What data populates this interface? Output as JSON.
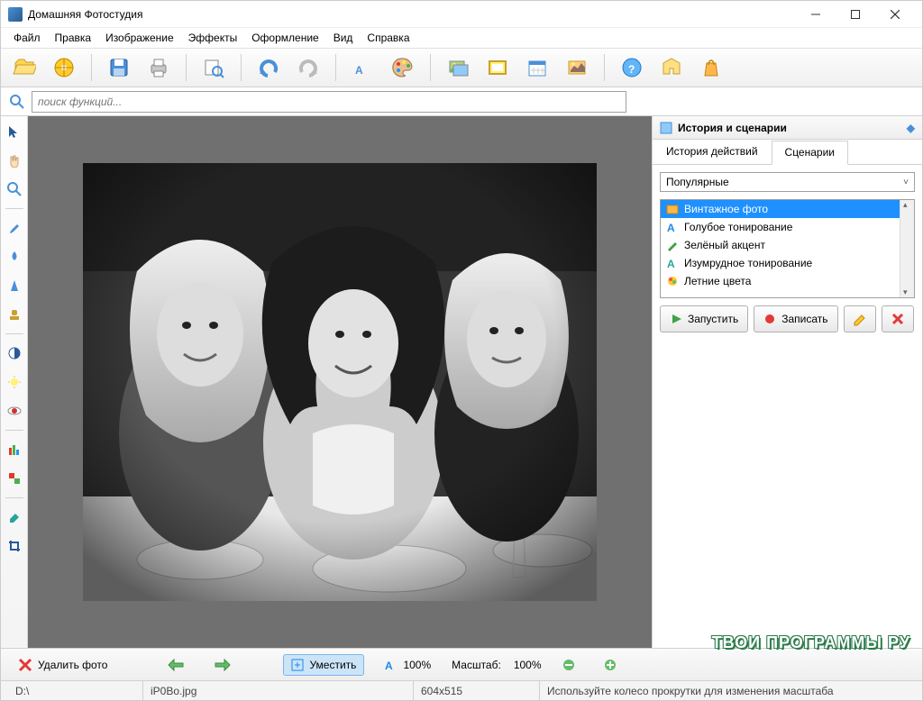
{
  "title": "Домашняя Фотостудия",
  "menu": [
    "Файл",
    "Правка",
    "Изображение",
    "Эффекты",
    "Оформление",
    "Вид",
    "Справка"
  ],
  "search": {
    "placeholder": "поиск функций..."
  },
  "sidepanel": {
    "title": "История и сценарии",
    "tabs": {
      "history": "История действий",
      "scenarios": "Сценарии"
    },
    "combo": "Популярные",
    "scenarios_list": [
      "Винтажное фото",
      "Голубое тонирование",
      "Зелёный акцент",
      "Изумрудное тонирование",
      "Летние цвета"
    ],
    "buttons": {
      "run": "Запустить",
      "record": "Записать"
    }
  },
  "bottom": {
    "delete": "Удалить фото",
    "fit": "Уместить",
    "hundred": "100%",
    "scale_label": "Масштаб:",
    "scale_value": "100%"
  },
  "status": {
    "path": "D:\\",
    "filename": "iP0Bo.jpg",
    "dims": "604x515",
    "hint": "Используйте колесо прокрутки для изменения масштаба"
  },
  "watermark": "ТВОИ ПРОГРАММЫ РУ"
}
